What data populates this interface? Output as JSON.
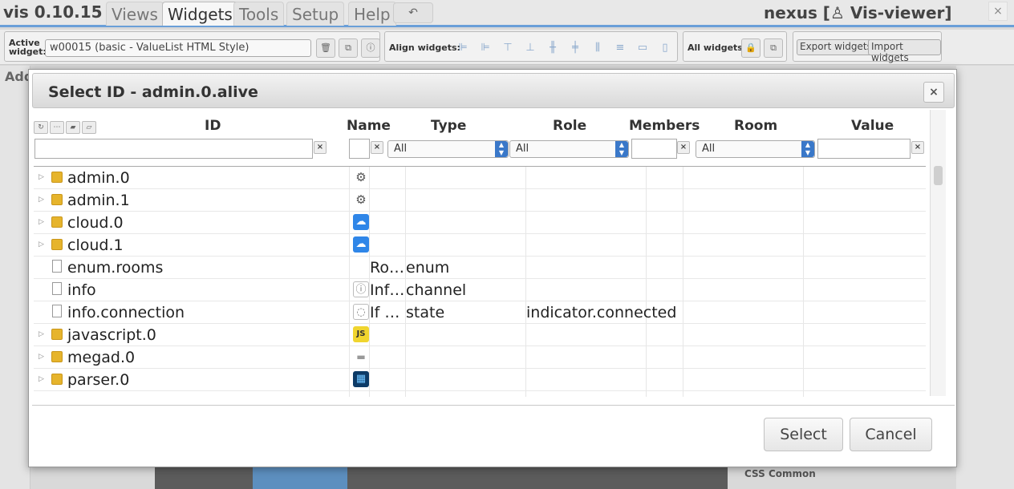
{
  "app": {
    "title": "vis 0.10.15",
    "menu": [
      "Views",
      "Widgets",
      "Tools",
      "Setup",
      "Help"
    ],
    "undo_icon": "↶",
    "project_title": "nexus [♙ Vis-viewer]",
    "close_icon": "×"
  },
  "toolbar": {
    "active_widget_label": "Active widget:",
    "active_widget_value": "w00015 (basic - ValueList HTML Style)",
    "align_label": "Align widgets:",
    "all_widgets_label": "All widgets:",
    "export_label": "Export widgets",
    "import_label": "Import widgets"
  },
  "background": {
    "left_tab": "Add",
    "css_common": "CSS Common"
  },
  "dialog": {
    "title": "Select ID - admin.0.alive",
    "close_label": "×",
    "columns": {
      "id": "ID",
      "name": "Name",
      "type": "Type",
      "role": "Role",
      "members": "Members",
      "room": "Room",
      "value": "Value"
    },
    "filters": {
      "id_value": "",
      "name_value": "",
      "type_selected": "All",
      "role_selected": "All",
      "members_value": "",
      "room_selected": "All",
      "value_value": "",
      "clear_label": "×"
    },
    "rows": [
      {
        "id": "admin.0",
        "name": "",
        "type": "",
        "role": "",
        "folder": true,
        "icon": "gear-icon",
        "glyph": "⚙"
      },
      {
        "id": "admin.1",
        "name": "",
        "type": "",
        "role": "",
        "folder": true,
        "icon": "gear-icon",
        "glyph": "⚙"
      },
      {
        "id": "cloud.0",
        "name": "",
        "type": "",
        "role": "",
        "folder": true,
        "icon": "cloud-icon",
        "glyph": "☁"
      },
      {
        "id": "cloud.1",
        "name": "",
        "type": "",
        "role": "",
        "folder": true,
        "icon": "cloud-icon",
        "glyph": "☁"
      },
      {
        "id": "enum.rooms",
        "name": "Ro…",
        "type": "enum",
        "role": "",
        "folder": false,
        "icon": "",
        "glyph": ""
      },
      {
        "id": "info",
        "name": "Inf…",
        "type": "channel",
        "role": "",
        "folder": false,
        "icon": "info-icon",
        "glyph": "ⓘ"
      },
      {
        "id": "info.connection",
        "name": "If …",
        "type": "state",
        "role": "indicator.connected",
        "folder": false,
        "icon": "info-icon",
        "glyph": "◌"
      },
      {
        "id": "javascript.0",
        "name": "",
        "type": "",
        "role": "",
        "folder": true,
        "icon": "js-icon",
        "glyph": "JS"
      },
      {
        "id": "megad.0",
        "name": "",
        "type": "",
        "role": "",
        "folder": true,
        "icon": "board-icon",
        "glyph": "▬"
      },
      {
        "id": "parser.0",
        "name": "",
        "type": "",
        "role": "",
        "folder": true,
        "icon": "parser-icon",
        "glyph": "▦"
      }
    ],
    "select_label": "Select",
    "cancel_label": "Cancel"
  }
}
